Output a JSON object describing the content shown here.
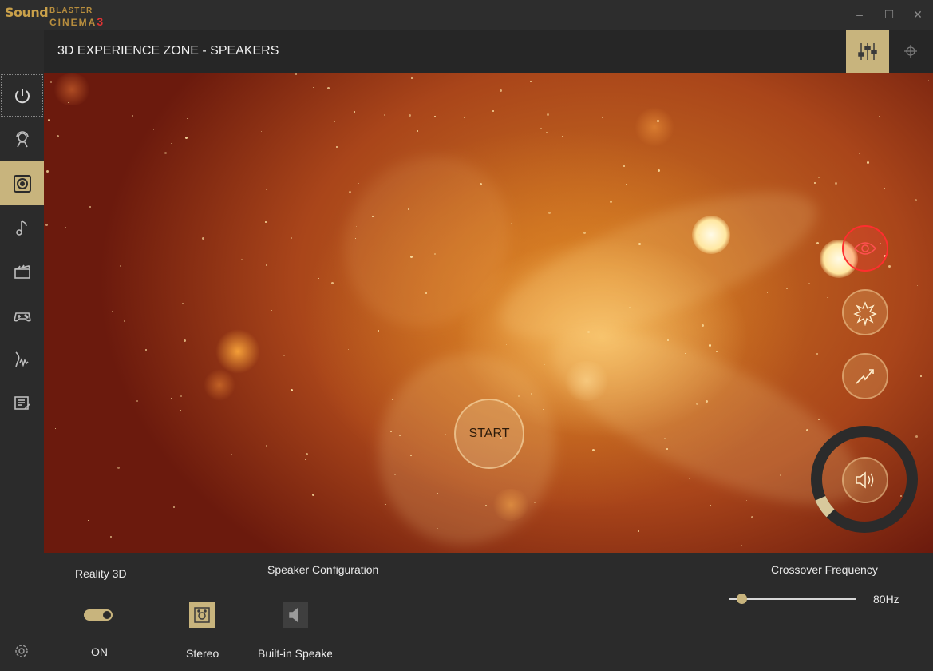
{
  "app": {
    "logo_sound": "Sound",
    "logo_blaster": "BLASTER",
    "logo_cinema": "CINEMA",
    "logo_version": "3"
  },
  "window_controls": {
    "minimize": "–",
    "maximize": "☐",
    "close": "✕"
  },
  "header": {
    "title": "3D EXPERIENCE ZONE - SPEAKERS"
  },
  "sidebar": {
    "items": [
      {
        "icon": "power-icon",
        "active": false
      },
      {
        "icon": "headset-user-icon",
        "active": false
      },
      {
        "icon": "speaker-icon",
        "active": true
      },
      {
        "icon": "music-note-icon",
        "active": false
      },
      {
        "icon": "clapperboard-icon",
        "active": false
      },
      {
        "icon": "gamepad-icon",
        "active": false
      },
      {
        "icon": "voice-wave-icon",
        "active": false
      },
      {
        "icon": "notes-icon",
        "active": false
      }
    ],
    "settings_icon": "gear-icon"
  },
  "stage": {
    "start_label": "START",
    "controls": [
      "eye-icon",
      "explosion-icon",
      "lightning-icon",
      "volume-icon"
    ],
    "volume_level": 0.08
  },
  "bottom": {
    "reality3d_label": "Reality 3D",
    "reality3d_state": "ON",
    "speaker_config_label": "Speaker Configuration",
    "stereo_label": "Stereo",
    "builtin_label": "Built-in Speaker",
    "crossover_label": "Crossover Frequency",
    "crossover_value": "80Hz"
  },
  "colors": {
    "accent": "#c8b47d",
    "background": "#2b2b2b",
    "header": "#262626",
    "red": "#ff2e2e"
  }
}
